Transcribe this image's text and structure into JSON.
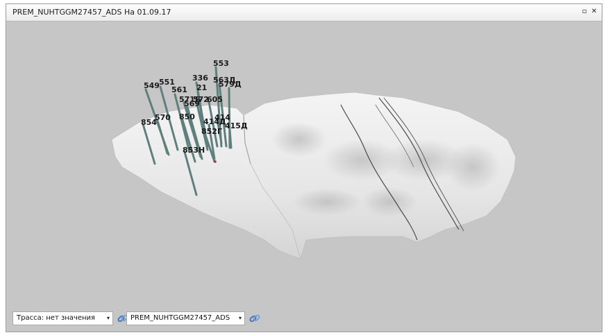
{
  "window": {
    "title": "PREM_NUHTGGM27457_ADS На 01.09.17",
    "restore_icon": "restore-icon",
    "close_icon": "close-icon",
    "restore_glyph": "▫",
    "close_glyph": "✕"
  },
  "scene": {
    "background_color": "#c6c6c6",
    "surface_color": "#ececec",
    "well_color": "#5f7f7d",
    "wells": [
      "553",
      "336",
      "563Д",
      "579Д",
      "549",
      "551",
      "21",
      "561",
      "571Б",
      "572",
      "605",
      "569",
      "414",
      "570",
      "850",
      "414Д",
      "854",
      "415Д",
      "852Г",
      "853Н"
    ]
  },
  "toolbar": {
    "trace_select": {
      "value": "Трасса: нет значения",
      "arrow": "▾"
    },
    "trace_link_icon": "link-icon",
    "model_select": {
      "value": "PREM_NUHTGGM27457_ADS",
      "arrow": "▾"
    },
    "model_link_icon": "link-icon"
  }
}
